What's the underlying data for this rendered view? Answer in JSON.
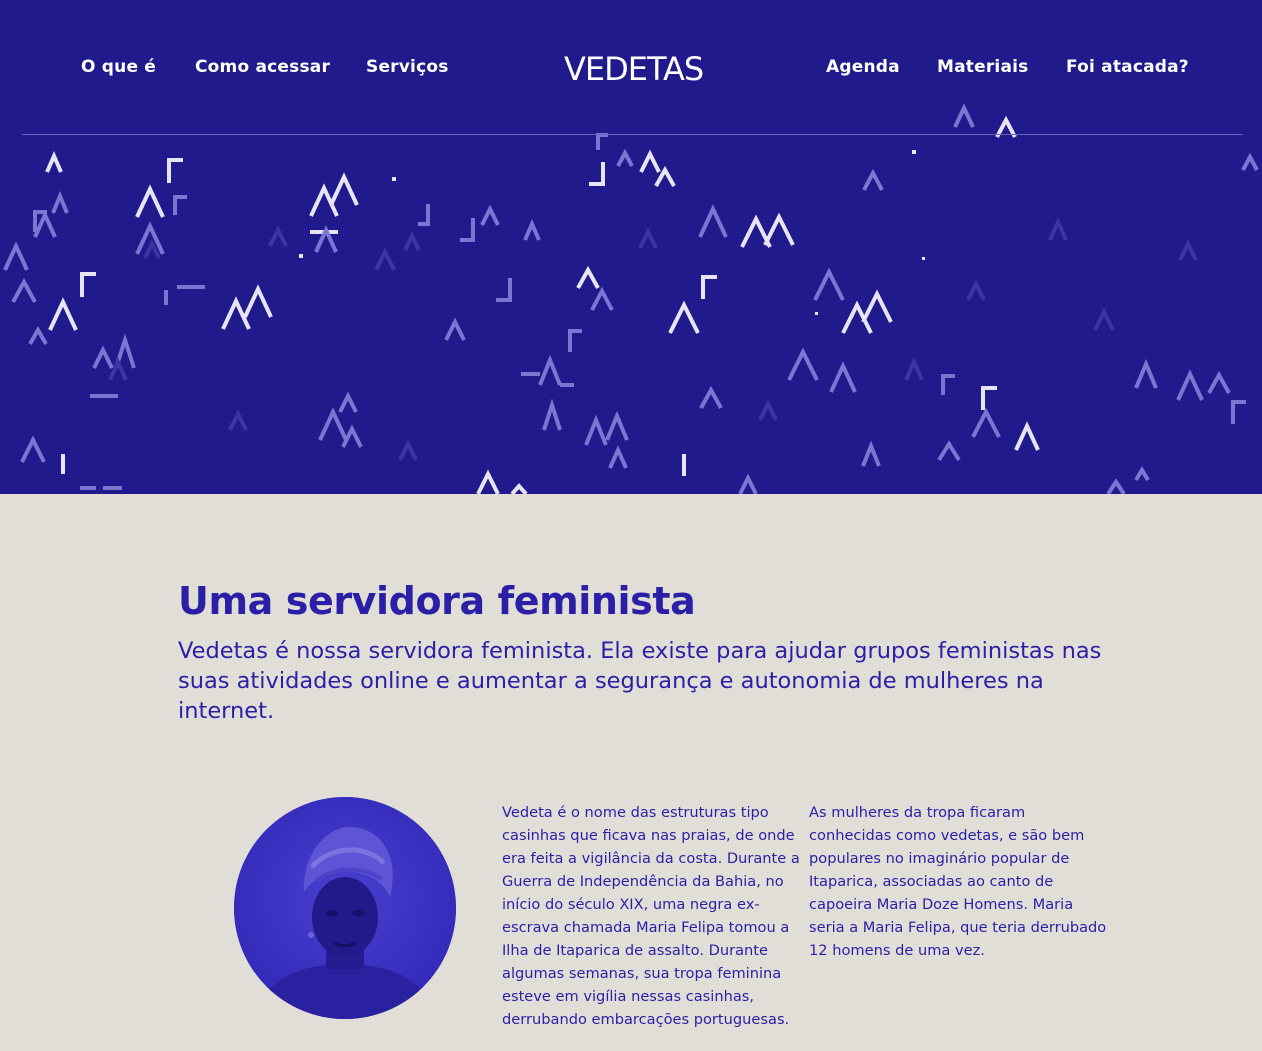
{
  "nav": {
    "left": [
      "O que é",
      "Como acessar",
      "Serviços"
    ],
    "brand": "VEDETAS",
    "right": [
      "Agenda",
      "Materiais",
      "Foi atacada?"
    ]
  },
  "intro": {
    "title": "Uma servidora feminista",
    "lead": "Vedetas é nossa servidora feminista. Ela existe para ajudar grupos feministas nas suas atividades online e aumentar a segurança e autonomia de mulheres na internet."
  },
  "story": {
    "col1": "Vedeta é o nome das estruturas tipo casinhas que ficava nas praias, de onde era feita a vigilância da costa. Durante a Guerra de Independência da Bahia, no início do século XIX, uma negra ex-escrava chamada Maria Felipa tomou a Ilha de Itaparica de assalto. Durante algumas semanas, sua tropa feminina esteve em vigília nessas casinhas, derrubando embarcações portuguesas.",
    "col2": "As mulheres da tropa ficaram conhecidas como vedetas, e são bem populares no imaginário popular de Itaparica, associadas ao canto de capoeira Maria Doze Homens. Maria seria a Maria Felipa, que teria derrubado 12 homens de uma vez."
  },
  "colors": {
    "hero_bg": "#211a8c",
    "page_bg": "#e1ded8",
    "accent": "#2a1fa6",
    "portrait_tint": "#3b30c4"
  },
  "icons": {
    "pattern": "caret-pattern",
    "portrait": "portrait-image"
  }
}
